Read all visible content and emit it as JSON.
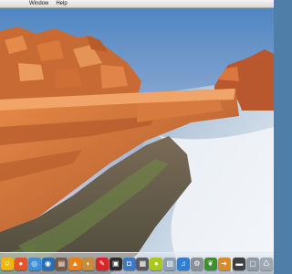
{
  "menubar": {
    "items": [
      {
        "label": "...indow"
      },
      {
        "label": "Help"
      }
    ],
    "items_full": [
      {
        "label": "Window"
      },
      {
        "label": "Help"
      }
    ]
  },
  "wallpaper": {
    "description_colors": {
      "sky_top": "#5d8fc0",
      "sky_bottom": "#dcd9e6",
      "rock": "#d2753a",
      "sea": "#c9d8e8"
    }
  },
  "dock": {
    "icons": [
      {
        "name": "finder-icon",
        "glyph": "☺",
        "color": "#f2b705"
      },
      {
        "name": "firefox-icon",
        "glyph": "●",
        "color": "#e3542a"
      },
      {
        "name": "safari-icon",
        "glyph": "◎",
        "color": "#3a8fe0"
      },
      {
        "name": "dashboard-icon",
        "glyph": "◉",
        "color": "#2a6db0"
      },
      {
        "name": "itunes-library-icon",
        "glyph": "▤",
        "color": "#7b5a44"
      },
      {
        "name": "vlc-icon",
        "glyph": "▲",
        "color": "#f07f12"
      },
      {
        "name": "photo-icon",
        "glyph": "◐",
        "color": "#c68b3d"
      },
      {
        "name": "notes-icon",
        "glyph": "✎",
        "color": "#d92525"
      },
      {
        "name": "frontrow-icon",
        "glyph": "▣",
        "color": "#2b2b2b"
      },
      {
        "name": "camera-icon",
        "glyph": "◘",
        "color": "#3d78c9"
      },
      {
        "name": "expose-icon",
        "glyph": "▦",
        "color": "#5a5a5a"
      },
      {
        "name": "ball-icon",
        "glyph": "●",
        "color": "#a8c81c"
      },
      {
        "name": "preview-icon",
        "glyph": "▧",
        "color": "#8fa0b3"
      },
      {
        "name": "music-icon",
        "glyph": "♫",
        "color": "#2c7fd6"
      },
      {
        "name": "system-preferences-icon",
        "glyph": "⚙",
        "color": "#8b8f96"
      },
      {
        "name": "leaf-icon",
        "glyph": "❦",
        "color": "#3f8f2e"
      },
      {
        "name": "document-icon",
        "glyph": "➜",
        "color": "#d98b2b"
      },
      {
        "name": "terminal-icon",
        "glyph": "▬",
        "color": "#404040"
      },
      {
        "name": "window-icon",
        "glyph": "▢",
        "color": "#909aa6"
      },
      {
        "name": "trash-icon",
        "glyph": "♺",
        "color": "#9fa9b4"
      }
    ]
  }
}
